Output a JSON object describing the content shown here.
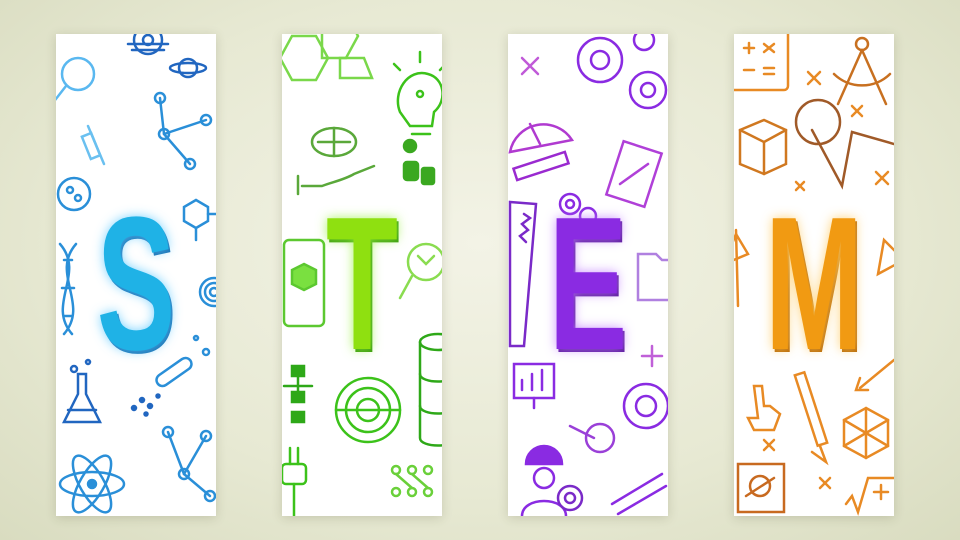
{
  "banners": [
    {
      "letter": "S",
      "theme": "science",
      "color": "#1fb2e6",
      "icons": [
        "magnifier-icon",
        "gear-icon",
        "planet-icon",
        "molecule-icon",
        "syringe-icon",
        "petri-dish-icon",
        "dna-icon",
        "hexagon-molecule-icon",
        "fingerprint-icon",
        "test-tube-icon",
        "flask-icon",
        "galaxy-icon",
        "atom-icon"
      ]
    },
    {
      "letter": "T",
      "theme": "technology",
      "color": "#8fe010",
      "icons": [
        "hexagon-grid-icon",
        "brain-idea-icon",
        "brain-hand-icon",
        "gadgets-icon",
        "tablet-cube-icon",
        "circuit-search-icon",
        "network-icon",
        "target-circuit-icon",
        "database-icon",
        "plug-icon",
        "circuit-board-icon"
      ]
    },
    {
      "letter": "E",
      "theme": "engineering",
      "color": "#8a2be2",
      "icons": [
        "gears-icon",
        "cross-icon",
        "protractor-icon",
        "ruler-pencil-icon",
        "blueprint-icon",
        "saw-icon",
        "folder-icon",
        "chart-presentation-icon",
        "worker-icon",
        "wrench-gear-icon",
        "plus-icon",
        "gear-icon"
      ]
    },
    {
      "letter": "M",
      "theme": "mathematics",
      "color": "#f19a12",
      "icons": [
        "calculator-icon",
        "compass-icon",
        "cube-icon",
        "angle-icon",
        "multiply-icon",
        "triangle-icon",
        "pencil-icon",
        "pointer-hand-icon",
        "polyhedron-icon",
        "sqrt-icon",
        "graph-icon"
      ]
    }
  ]
}
